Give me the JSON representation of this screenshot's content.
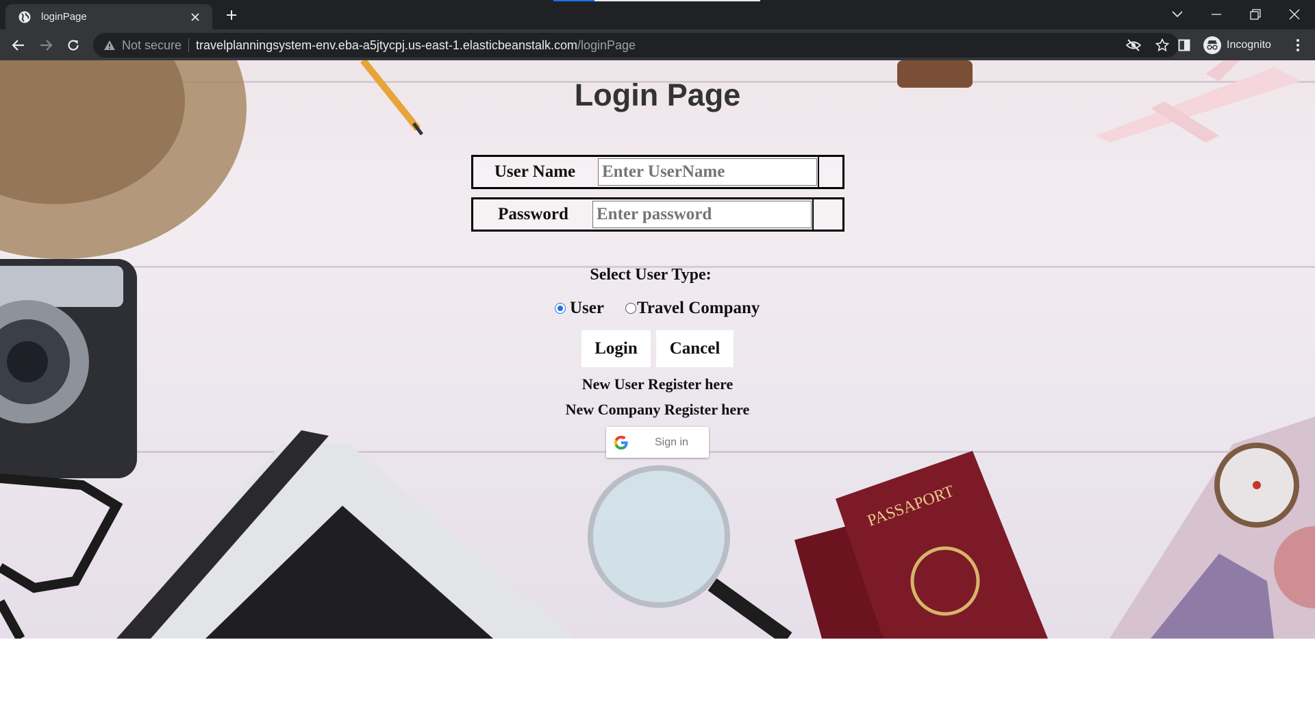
{
  "browser": {
    "tab": {
      "title": "loginPage"
    },
    "address_bar": {
      "security_label": "Not secure",
      "url_host": "travelplanningsystem-env.eba-a5jtycpj.us-east-1.elasticbeanstalk.com",
      "url_path": "/loginPage"
    },
    "profile_label": "Incognito"
  },
  "page": {
    "title": "Login Page",
    "username": {
      "label": "User Name",
      "placeholder": "Enter UserName",
      "value": ""
    },
    "password": {
      "label": "Password",
      "placeholder": "Enter password",
      "value": ""
    },
    "user_type": {
      "label": "Select User Type:",
      "options": [
        "User",
        "Travel Company"
      ],
      "selected": "User"
    },
    "buttons": {
      "login": "Login",
      "cancel": "Cancel"
    },
    "links": {
      "new_user": "New User Register here",
      "new_company": "New Company Register here"
    },
    "google_signin": {
      "label": "Sign in"
    }
  },
  "colors": {
    "chrome_dark": "#202124",
    "chrome_toolbar": "#35363a",
    "title_text": "#333333",
    "radio_accent": "#1a73e8"
  },
  "icons": [
    "globe-favicon-icon",
    "close-icon",
    "plus-icon",
    "chevron-down-icon",
    "minimize-icon",
    "restore-icon",
    "window-close-icon",
    "back-icon",
    "forward-icon",
    "reload-icon",
    "warning-icon",
    "eye-off-icon",
    "star-icon",
    "side-panel-icon",
    "incognito-icon",
    "kebab-menu-icon",
    "google-g-icon"
  ]
}
